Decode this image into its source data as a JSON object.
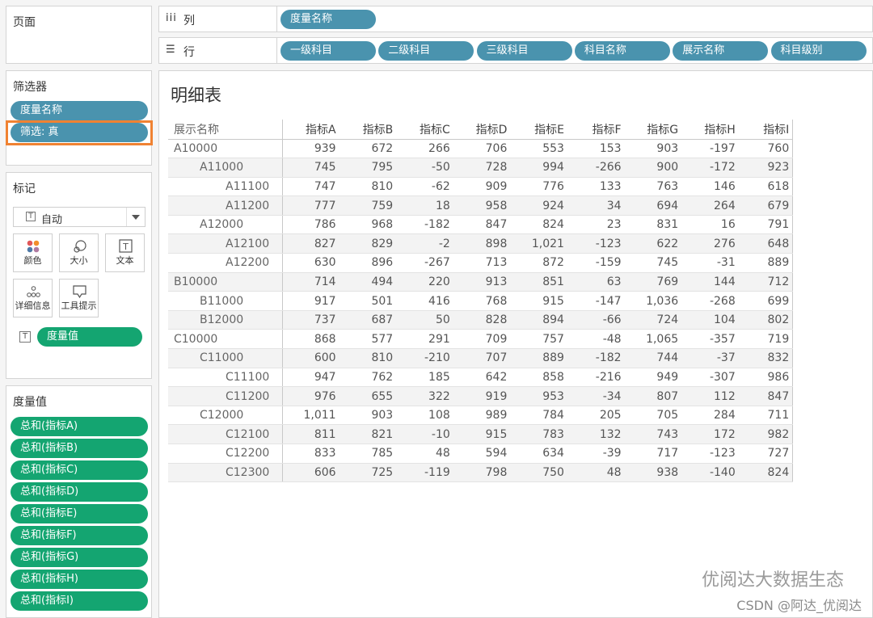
{
  "sidebar": {
    "pages_title": "页面",
    "filters_title": "筛选器",
    "filters": [
      "度量名称",
      "筛选: 真"
    ],
    "marks_title": "标记",
    "mark_type": "自动",
    "mark_buttons": [
      "颜色",
      "大小",
      "文本",
      "详细信息",
      "工具提示"
    ],
    "mark_text_field": "度量值",
    "measure_values_title": "度量值",
    "measures": [
      "总和(指标A)",
      "总和(指标B)",
      "总和(指标C)",
      "总和(指标D)",
      "总和(指标E)",
      "总和(指标F)",
      "总和(指标G)",
      "总和(指标H)",
      "总和(指标I)"
    ]
  },
  "shelves": {
    "columns_label": "列",
    "columns": [
      "度量名称"
    ],
    "rows_label": "行",
    "rows": [
      "一级科目",
      "二级科目",
      "三级科目",
      "科目名称",
      "展示名称",
      "科目级别"
    ]
  },
  "sheet": {
    "title": "明细表",
    "row_header": "展示名称",
    "columns": [
      "指标A",
      "指标B",
      "指标C",
      "指标D",
      "指标E",
      "指标F",
      "指标G",
      "指标H",
      "指标I"
    ],
    "rows": [
      {
        "name": "A10000",
        "level": 0,
        "values": [
          "939",
          "672",
          "266",
          "706",
          "553",
          "153",
          "903",
          "-197",
          "760"
        ]
      },
      {
        "name": "A11000",
        "level": 1,
        "values": [
          "745",
          "795",
          "-50",
          "728",
          "994",
          "-266",
          "900",
          "-172",
          "923"
        ]
      },
      {
        "name": "A11100",
        "level": 2,
        "values": [
          "747",
          "810",
          "-62",
          "909",
          "776",
          "133",
          "763",
          "146",
          "618"
        ]
      },
      {
        "name": "A11200",
        "level": 2,
        "values": [
          "777",
          "759",
          "18",
          "958",
          "924",
          "34",
          "694",
          "264",
          "679"
        ]
      },
      {
        "name": "A12000",
        "level": 1,
        "values": [
          "786",
          "968",
          "-182",
          "847",
          "824",
          "23",
          "831",
          "16",
          "791"
        ]
      },
      {
        "name": "A12100",
        "level": 2,
        "values": [
          "827",
          "829",
          "-2",
          "898",
          "1,021",
          "-123",
          "622",
          "276",
          "648"
        ]
      },
      {
        "name": "A12200",
        "level": 2,
        "values": [
          "630",
          "896",
          "-267",
          "713",
          "872",
          "-159",
          "745",
          "-31",
          "889"
        ]
      },
      {
        "name": "B10000",
        "level": 0,
        "values": [
          "714",
          "494",
          "220",
          "913",
          "851",
          "63",
          "769",
          "144",
          "712"
        ]
      },
      {
        "name": "B11000",
        "level": 1,
        "values": [
          "917",
          "501",
          "416",
          "768",
          "915",
          "-147",
          "1,036",
          "-268",
          "699"
        ]
      },
      {
        "name": "B12000",
        "level": 1,
        "values": [
          "737",
          "687",
          "50",
          "828",
          "894",
          "-66",
          "724",
          "104",
          "802"
        ]
      },
      {
        "name": "C10000",
        "level": 0,
        "values": [
          "868",
          "577",
          "291",
          "709",
          "757",
          "-48",
          "1,065",
          "-357",
          "719"
        ]
      },
      {
        "name": "C11000",
        "level": 1,
        "values": [
          "600",
          "810",
          "-210",
          "707",
          "889",
          "-182",
          "744",
          "-37",
          "832"
        ]
      },
      {
        "name": "C11100",
        "level": 2,
        "values": [
          "947",
          "762",
          "185",
          "642",
          "858",
          "-216",
          "949",
          "-307",
          "986"
        ]
      },
      {
        "name": "C11200",
        "level": 2,
        "values": [
          "976",
          "655",
          "322",
          "919",
          "953",
          "-34",
          "807",
          "112",
          "847"
        ]
      },
      {
        "name": "C12000",
        "level": 1,
        "values": [
          "1,011",
          "903",
          "108",
          "989",
          "784",
          "205",
          "705",
          "284",
          "711"
        ]
      },
      {
        "name": "C12100",
        "level": 2,
        "values": [
          "811",
          "821",
          "-10",
          "915",
          "783",
          "132",
          "743",
          "172",
          "982"
        ]
      },
      {
        "name": "C12200",
        "level": 2,
        "values": [
          "833",
          "785",
          "48",
          "594",
          "634",
          "-39",
          "717",
          "-123",
          "727"
        ]
      },
      {
        "name": "C12300",
        "level": 2,
        "values": [
          "606",
          "725",
          "-119",
          "798",
          "750",
          "48",
          "938",
          "-140",
          "824"
        ]
      }
    ]
  },
  "watermark": {
    "line1": "优阅达大数据生态",
    "line2": "CSDN @阿达_优阅达"
  },
  "colors": {
    "dimension_pill": "#4a93ae",
    "measure_pill": "#14a571",
    "highlight_border": "#f08232"
  }
}
